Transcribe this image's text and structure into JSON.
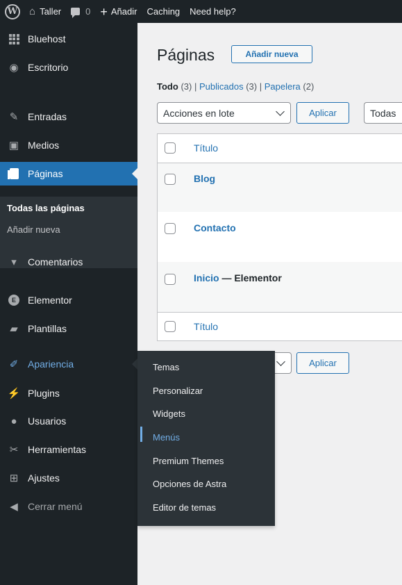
{
  "adminbar": {
    "wp_logo": "W",
    "site_name": "Taller",
    "comments_count": "0",
    "new_label": "Añadir",
    "caching_label": "Caching",
    "help_label": "Need help?"
  },
  "sidebar": {
    "items": [
      {
        "label": "Bluehost",
        "icon": "grid-icon"
      },
      {
        "label": "Escritorio",
        "icon": "dashboard-icon"
      },
      {
        "label": "Entradas",
        "icon": "pin-icon"
      },
      {
        "label": "Medios",
        "icon": "media-icon"
      },
      {
        "label": "Páginas",
        "icon": "page-icon"
      },
      {
        "label": "Comentarios",
        "icon": "comment-icon"
      },
      {
        "label": "Elementor",
        "icon": "elementor-icon"
      },
      {
        "label": "Plantillas",
        "icon": "folder-icon"
      },
      {
        "label": "Apariencia",
        "icon": "brush-icon"
      },
      {
        "label": "Plugins",
        "icon": "plug-icon"
      },
      {
        "label": "Usuarios",
        "icon": "users-icon"
      },
      {
        "label": "Herramientas",
        "icon": "wrench-icon"
      },
      {
        "label": "Ajustes",
        "icon": "settings-icon"
      },
      {
        "label": "Cerrar menú",
        "icon": "collapse-icon"
      }
    ],
    "pages_submenu": [
      "Todas las páginas",
      "Añadir nueva"
    ]
  },
  "flyout": {
    "items": [
      "Temas",
      "Personalizar",
      "Widgets",
      "Menús",
      "Premium Themes",
      "Opciones de Astra",
      "Editor de temas"
    ]
  },
  "main": {
    "title": "Páginas",
    "add_new": "Añadir nueva",
    "filters": {
      "all_label": "Todo",
      "all_count": "(3)",
      "sep": "|",
      "published_label": "Publicados",
      "published_count": "(3)",
      "trash_label": "Papelera",
      "trash_count": "(2)"
    },
    "bulk_actions": "Acciones en lote",
    "apply": "Aplicar",
    "all_dates": "Todas",
    "table": {
      "header_title": "Título",
      "footer_title": "Título",
      "rows": [
        {
          "title": "Blog",
          "state": ""
        },
        {
          "title": "Contacto",
          "state": ""
        },
        {
          "title": "Inicio",
          "state": " — Elementor"
        }
      ]
    }
  },
  "colors": {
    "admin_dark": "#1d2327",
    "submenu_dark": "#2c3338",
    "accent_blue": "#2271b1",
    "hover_blue": "#72aee6",
    "content_bg": "#f0f0f1"
  }
}
